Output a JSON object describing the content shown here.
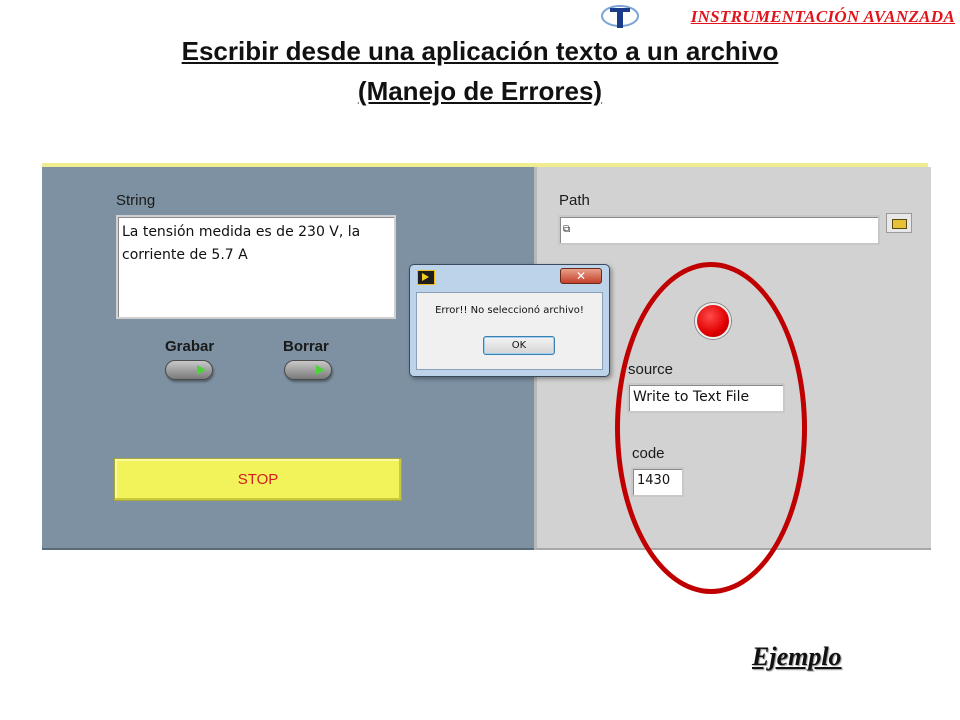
{
  "header": {
    "brand": "INSTRUMENTACIÓN AVANZADA",
    "title_line1": "Escribir desde una aplicación texto a un archivo",
    "title_line2": "(Manejo de Errores)"
  },
  "front_panel": {
    "string": {
      "label": "String",
      "value": "La tensión medida es de 230 V, la corriente de 5.7 A"
    },
    "grabar_label": "Grabar",
    "borrar_label": "Borrar",
    "stop_label": "STOP",
    "path": {
      "label": "Path",
      "value": ""
    },
    "error_cluster": {
      "status_color": "#e00000",
      "source_label": "source",
      "source_value": "Write to Text File",
      "code_label": "code",
      "code_value": "1430"
    }
  },
  "dialog": {
    "close_glyph": "✕",
    "message": "Error!! No seleccionó archivo!",
    "ok_label": "OK"
  },
  "footer": {
    "label": "Ejemplo"
  },
  "colors": {
    "brand_red": "#e0141c",
    "highlight_ring": "#c00000",
    "stop_yellow": "#f2f25a"
  }
}
